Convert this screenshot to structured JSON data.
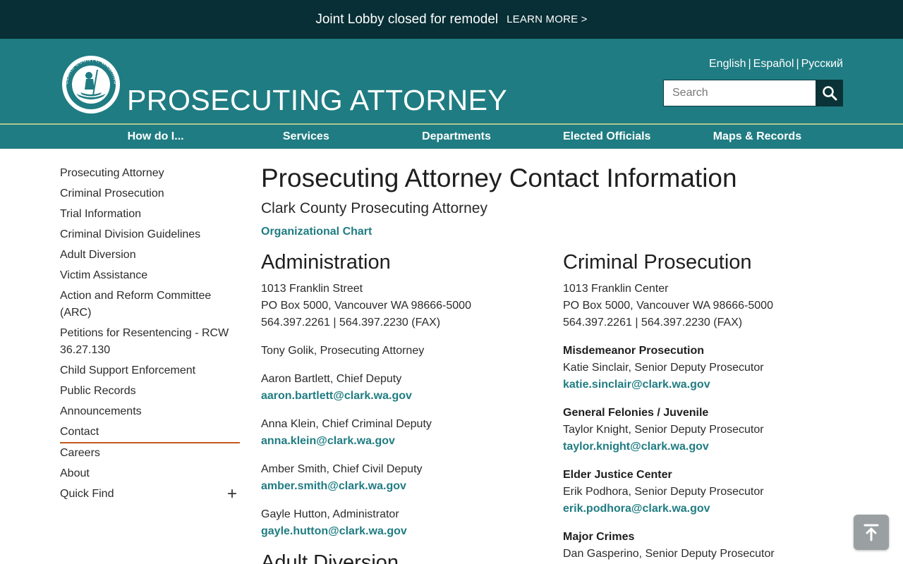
{
  "alert": {
    "text": "Joint Lobby closed for remodel",
    "link": "LEARN MORE >"
  },
  "header": {
    "seal_text": "CLARK COUNTY, WASHINGTON",
    "title": "PROSECUTING ATTORNEY",
    "languages": [
      "English",
      "Español",
      "Русский"
    ],
    "search_placeholder": "Search"
  },
  "nav": [
    "How do I...",
    "Services",
    "Departments",
    "Elected Officials",
    "Maps & Records"
  ],
  "sidebar": {
    "items": [
      "Prosecuting Attorney",
      "Criminal Prosecution",
      "Trial Information",
      "Criminal Division Guidelines",
      "Adult Diversion",
      "Victim Assistance",
      "Action and Reform Committee (ARC)",
      "Petitions for Resentencing - RCW 36.27.130",
      "Child Support Enforcement",
      "Public Records",
      "Announcements",
      "Contact",
      "Careers",
      "About"
    ],
    "quick_find": "Quick Find",
    "quick_find_toggle": "+"
  },
  "main": {
    "title": "Prosecuting Attorney Contact Information",
    "subtitle": "Clark County Prosecuting Attorney",
    "org_chart_link": "Organizational Chart",
    "administration": {
      "title": "Administration",
      "address": [
        "1013 Franklin Street",
        "PO Box 5000, Vancouver WA 98666-5000",
        "564.397.2261 | 564.397.2230 (FAX)"
      ],
      "head": "Tony Golik, Prosecuting Attorney",
      "people": [
        {
          "name": "Aaron Bartlett, Chief Deputy",
          "email": "aaron.bartlett@clark.wa.gov"
        },
        {
          "name": "Anna Klein, Chief Criminal Deputy",
          "email": "anna.klein@clark.wa.gov"
        },
        {
          "name": "Amber Smith, Chief Civil Deputy",
          "email": "amber.smith@clark.wa.gov"
        },
        {
          "name": "Gayle Hutton, Administrator",
          "email": "gayle.hutton@clark.wa.gov"
        }
      ]
    },
    "adult_diversion_title": "Adult Diversion",
    "criminal": {
      "title": "Criminal Prosecution",
      "address": [
        "1013 Franklin Center",
        "PO Box 5000, Vancouver WA 98666-5000",
        "564.397.2261 | 564.397.2230 (FAX)"
      ],
      "units": [
        {
          "unit": "Misdemeanor Prosecution",
          "name": "Katie Sinclair, Senior Deputy Prosecutor",
          "email": "katie.sinclair@clark.wa.gov"
        },
        {
          "unit": "General Felonies / Juvenile",
          "name": "Taylor Knight, Senior Deputy Prosecutor",
          "email": "taylor.knight@clark.wa.gov"
        },
        {
          "unit": "Elder Justice Center",
          "name": "Erik Podhora, Senior Deputy Prosecutor",
          "email": "erik.podhora@clark.wa.gov"
        },
        {
          "unit": "Major Crimes",
          "name": "Dan Gasperino, Senior Deputy Prosecutor"
        }
      ]
    }
  },
  "colors": {
    "alert_bg": "#072f35",
    "header_bg": "#1f7c82",
    "nav_border": "#a9c98a",
    "link": "#1f7c82",
    "active_underline": "#c05a20"
  },
  "icons": {
    "search": "search-icon",
    "back_to_top": "arrow-up-to-top-icon",
    "seal": "county-seal-logo"
  }
}
